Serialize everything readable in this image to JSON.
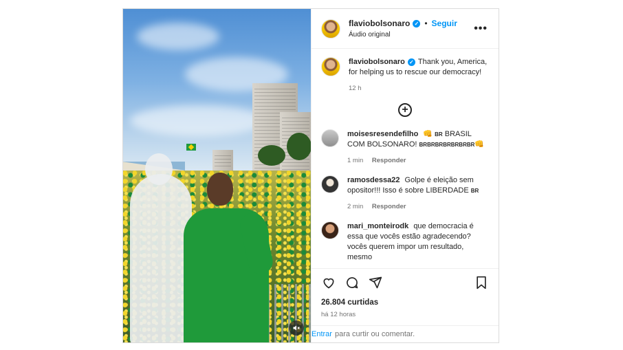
{
  "header": {
    "username": "flaviobolsonaro",
    "separator": "•",
    "follow_label": "Seguir",
    "audio_label": "Áudio original",
    "more_label": "•••"
  },
  "caption": {
    "username": "flaviobolsonaro",
    "text": "Thank you, America, for helping us to rescue our democracy!",
    "time": "12 h"
  },
  "load_more_label": "+",
  "comments": [
    {
      "username": "moisesresendefilho",
      "text_a": "👊",
      "flag_a": "BR",
      "text_b": "BRASIL COM BOLSONARO!",
      "flag_b": "BRBRBRBRBRBRBR",
      "text_c": "👊",
      "time": "1 min",
      "reply_label": "Responder"
    },
    {
      "username": "ramosdessa22",
      "text_a": "Golpe é eleição sem opositor!!! Isso é sobre LIBERDADE",
      "flag_a": "BR",
      "time": "2 min",
      "reply_label": "Responder"
    },
    {
      "username": "mari_monteirodk",
      "text_a": "que democracia é essa que vocês estão agradecendo? vocês querem impor um resultado, mesmo"
    }
  ],
  "likes": "26.804 curtidas",
  "posted": "há 12 horas",
  "add_comment": {
    "login_label": "Entrar",
    "rest_label": "para curtir ou comentar."
  },
  "colors": {
    "accent": "#0095f6",
    "shirt": "#1f9a3a",
    "text": "#262626",
    "muted": "#737373"
  }
}
